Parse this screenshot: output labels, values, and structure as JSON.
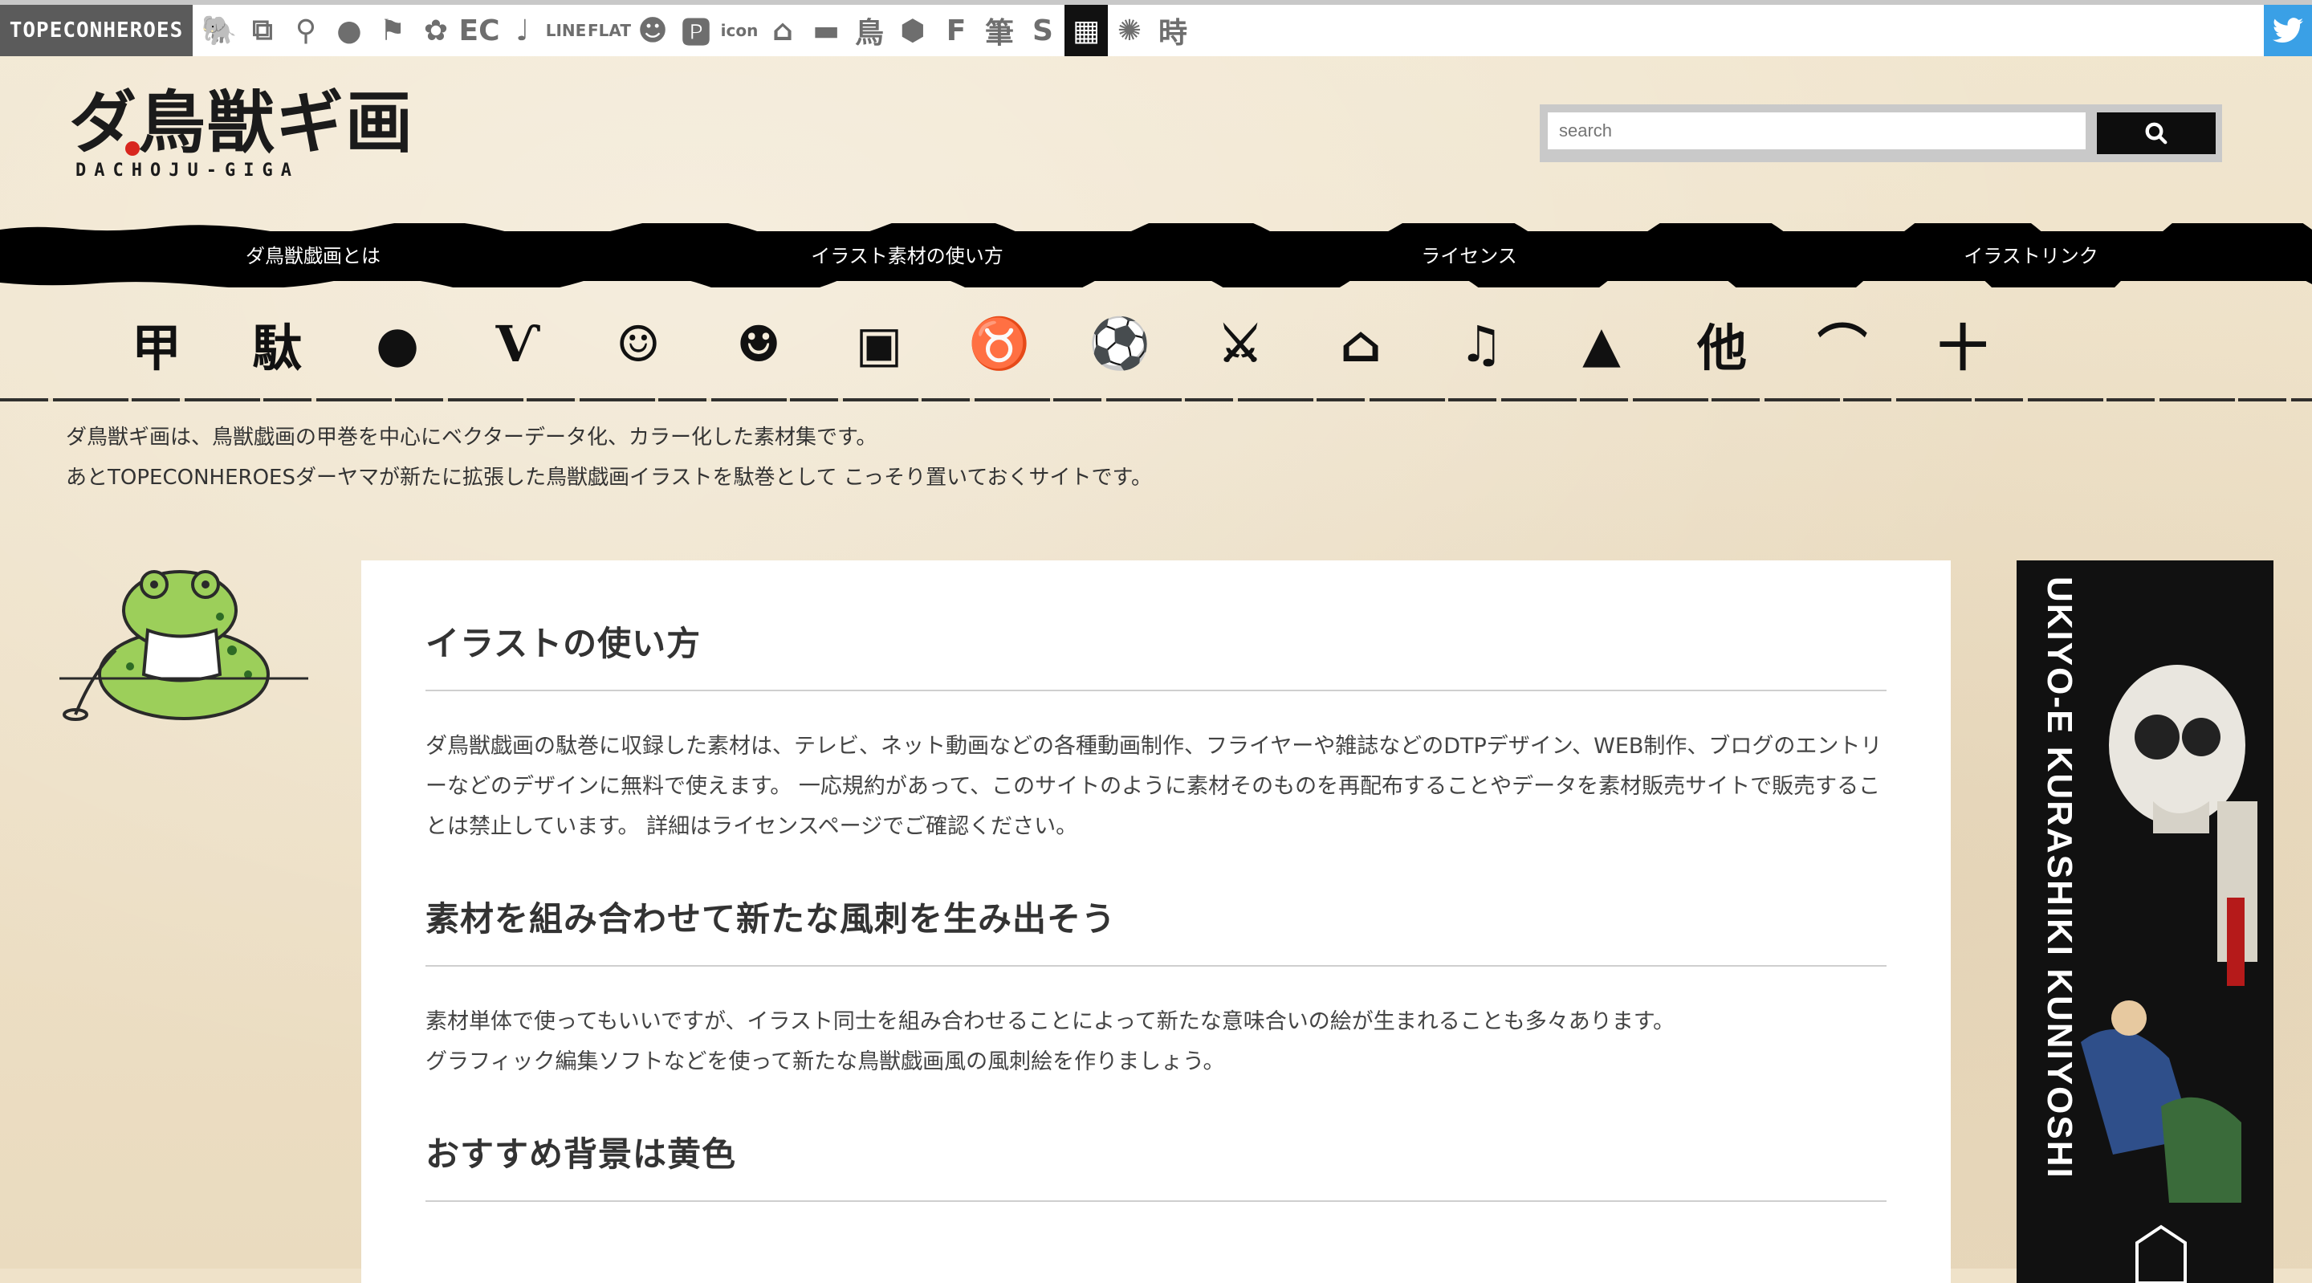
{
  "topbar": {
    "brand": "TOPECONHEROES",
    "icons": [
      {
        "name": "animal-icon",
        "glyph": "🐘"
      },
      {
        "name": "copy-icon",
        "glyph": "⧉"
      },
      {
        "name": "figure-icon",
        "glyph": "⚲"
      },
      {
        "name": "speech-bubble-icon",
        "glyph": "●"
      },
      {
        "name": "flag-icon",
        "glyph": "⚑"
      },
      {
        "name": "flower-icon",
        "glyph": "✿"
      },
      {
        "name": "ec-icon",
        "glyph": "EC"
      },
      {
        "name": "music-note-icon",
        "glyph": "♩"
      },
      {
        "name": "line-icon",
        "glyph": "LINE"
      },
      {
        "name": "flat-icon",
        "glyph": "FLAT"
      },
      {
        "name": "smiley-icon",
        "glyph": "☻"
      },
      {
        "name": "p-icon",
        "glyph": "🅿"
      },
      {
        "name": "icon-text-icon",
        "glyph": "icon"
      },
      {
        "name": "building-icon",
        "glyph": "⌂"
      },
      {
        "name": "bed-icon",
        "glyph": "▬"
      },
      {
        "name": "bird-kanji-icon",
        "glyph": "鳥"
      },
      {
        "name": "hexagon-icon",
        "glyph": "⬢"
      },
      {
        "name": "f-icon",
        "glyph": "F"
      },
      {
        "name": "brush-kanji-icon",
        "glyph": "筆"
      },
      {
        "name": "s-icon",
        "glyph": "S"
      },
      {
        "name": "grid-icon",
        "glyph": "▦"
      },
      {
        "name": "burst-icon",
        "glyph": "✺"
      },
      {
        "name": "time-kanji-icon",
        "glyph": "時"
      }
    ],
    "twitter_icon": "twitter-icon"
  },
  "logo": {
    "title": "ダ鳥獣ギ画",
    "subtitle": "DACHOJU-GIGA"
  },
  "search": {
    "placeholder": "search",
    "button_icon": "search-icon"
  },
  "nav": {
    "items": [
      "ダ鳥獣戯画とは",
      "イラスト素材の使い方",
      "ライセンス",
      "イラストリンク"
    ]
  },
  "categories": [
    {
      "name": "category-kou-icon",
      "glyph": "甲"
    },
    {
      "name": "category-da-icon",
      "glyph": "駄"
    },
    {
      "name": "category-frog-icon",
      "glyph": "●"
    },
    {
      "name": "category-rabbit-icon",
      "glyph": "Ѵ"
    },
    {
      "name": "category-monkey-icon",
      "glyph": "☺"
    },
    {
      "name": "category-face-icon",
      "glyph": "☻"
    },
    {
      "name": "category-bag-icon",
      "glyph": "▣"
    },
    {
      "name": "category-tongue-icon",
      "glyph": "♉"
    },
    {
      "name": "category-ball-icon",
      "glyph": "⚽"
    },
    {
      "name": "category-swords-icon",
      "glyph": "⚔"
    },
    {
      "name": "category-school-icon",
      "glyph": "⌂"
    },
    {
      "name": "category-music-icon",
      "glyph": "♫"
    },
    {
      "name": "category-mountain-icon",
      "glyph": "▲"
    },
    {
      "name": "category-other-icon",
      "glyph": "他"
    },
    {
      "name": "category-landscape-icon",
      "glyph": "⌒"
    },
    {
      "name": "category-plus-icon",
      "glyph": "十"
    }
  ],
  "intro": {
    "line1": "ダ鳥獣ギ画は、鳥獣戯画の甲巻を中心にベクターデータ化、カラー化した素材集です。",
    "line2": "あとTOPECONHEROESダーヤマが新たに拡張した鳥獣戯画イラストを駄巻として こっそり置いておくサイトです。"
  },
  "main": {
    "section1": {
      "heading": "イラストの使い方",
      "body": "ダ鳥獣戯画の駄巻に収録した素材は、テレビ、ネット動画などの各種動画制作、フライヤーや雑誌などのDTPデザイン、WEB制作、ブログのエントリーなどのデザインに無料で使えます。 一応規約があって、このサイトのように素材そのものを再配布することやデータを素材販売サイトで販売することは禁止しています。 詳細はライセンスページでご確認ください。"
    },
    "section2": {
      "heading": "素材を組み合わせて新たな風刺を生み出そう",
      "body_line1": "素材単体で使ってもいいですが、イラスト同士を組み合わせることによって新たな意味合いの絵が生まれることも多々あります。",
      "body_line2": "グラフィック編集ソフトなどを使って新たな鳥獣戯画風の風刺絵を作りましょう。"
    },
    "section3": {
      "heading": "おすすめ背景は黄色"
    }
  },
  "ad": {
    "text": "UKIYO-E KURASHIKI KUNIYOSHI"
  }
}
